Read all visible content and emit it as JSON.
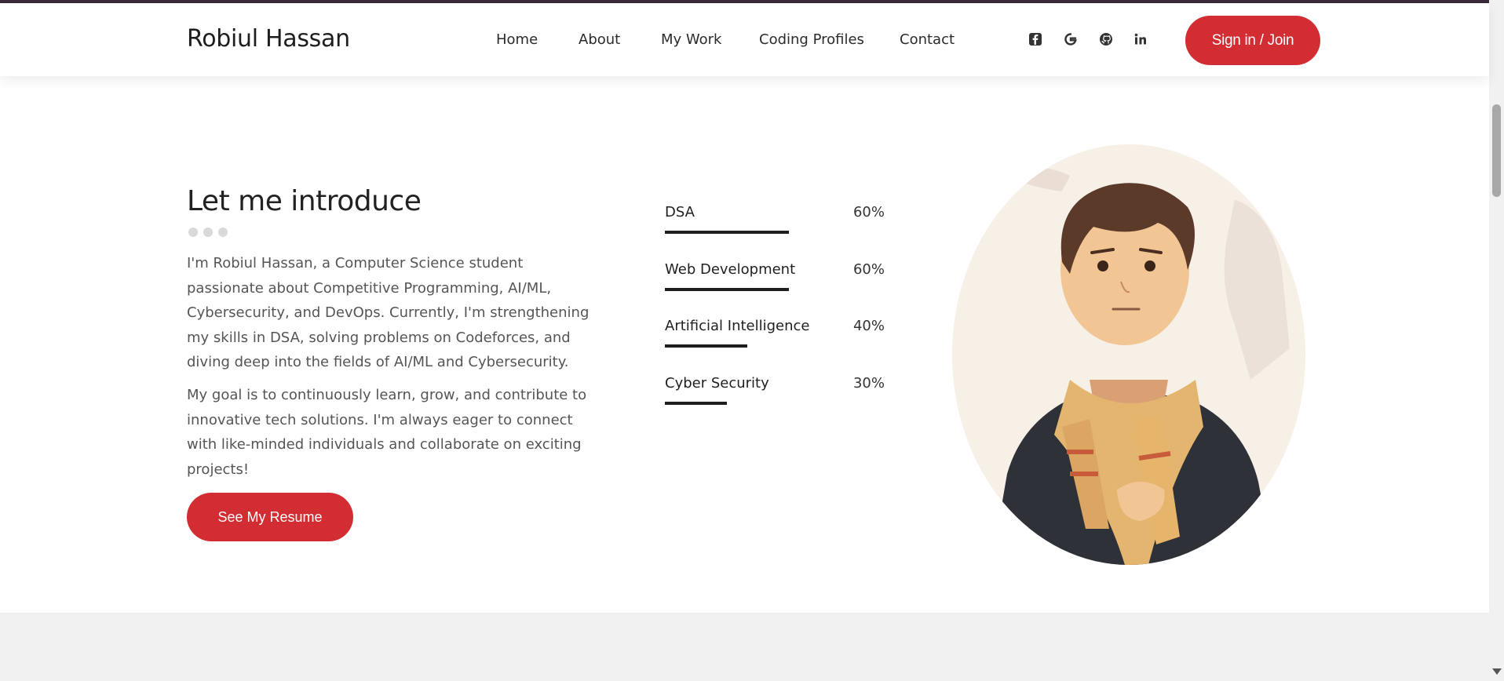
{
  "header": {
    "brand": "Robiul Hassan",
    "nav": [
      "Home",
      "About",
      "My Work",
      "Coding Profiles",
      "Contact"
    ],
    "social_icons": [
      "facebook-icon",
      "google-icon",
      "github-icon",
      "linkedin-icon"
    ],
    "signin_label": "Sign in / Join"
  },
  "intro": {
    "title": "Let me introduce",
    "paragraph1": "I'm Robiul Hassan, a Computer Science student passionate about Competitive Programming, AI/ML, Cybersecurity, and DevOps. Currently, I'm strengthening my skills in DSA, solving problems on Codeforces, and diving deep into the fields of AI/ML and Cybersecurity.",
    "paragraph2": "My goal is to continuously learn, grow, and contribute to innovative tech solutions. I'm always eager to connect with like-minded individuals and collaborate on exciting projects!",
    "resume_label": "See My Resume"
  },
  "skills": [
    {
      "name": "DSA",
      "percent_label": "60%",
      "percent": 60
    },
    {
      "name": "Web Development",
      "percent_label": "60%",
      "percent": 60
    },
    {
      "name": "Artificial Intelligence",
      "percent_label": "40%",
      "percent": 40
    },
    {
      "name": "Cyber Security",
      "percent_label": "30%",
      "percent": 30
    }
  ],
  "colors": {
    "accent": "#d22d33",
    "text": "#222222",
    "muted": "#555555",
    "section_gray": "#f0f0f0"
  }
}
